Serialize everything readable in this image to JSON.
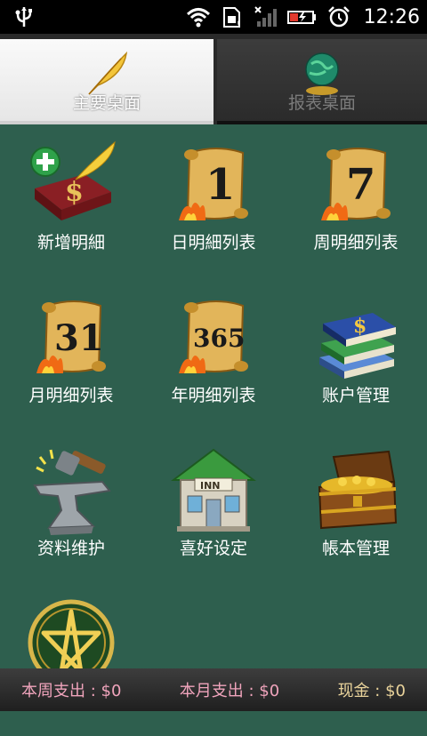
{
  "status_bar": {
    "time": "12:26"
  },
  "tabs": [
    {
      "label": "主要桌面",
      "icon": "feather-icon",
      "selected": true
    },
    {
      "label": "报表桌面",
      "icon": "globe-icon",
      "selected": false
    }
  ],
  "grid": {
    "items": [
      {
        "label": "新增明細",
        "icon": "add-ledger-icon"
      },
      {
        "label": "日明細列表",
        "icon": "daily-scroll-icon"
      },
      {
        "label": "周明细列表",
        "icon": "weekly-scroll-icon"
      },
      {
        "label": "月明细列表",
        "icon": "monthly-scroll-icon"
      },
      {
        "label": "年明细列表",
        "icon": "yearly-scroll-icon"
      },
      {
        "label": "账户管理",
        "icon": "books-icon"
      },
      {
        "label": "资料维护",
        "icon": "anvil-icon"
      },
      {
        "label": "喜好设定",
        "icon": "inn-icon"
      },
      {
        "label": "帳本管理",
        "icon": "treasure-chest-icon"
      },
      {
        "label": "",
        "icon": "pentagram-icon"
      }
    ]
  },
  "summary": {
    "week": "本周支出 : $0",
    "month": "本月支出 : $0",
    "cash": "现金 : $0"
  },
  "colors": {
    "background": "#2e5f4e",
    "week_text": "#f0a4bc",
    "cash_text": "#e9d39b"
  }
}
